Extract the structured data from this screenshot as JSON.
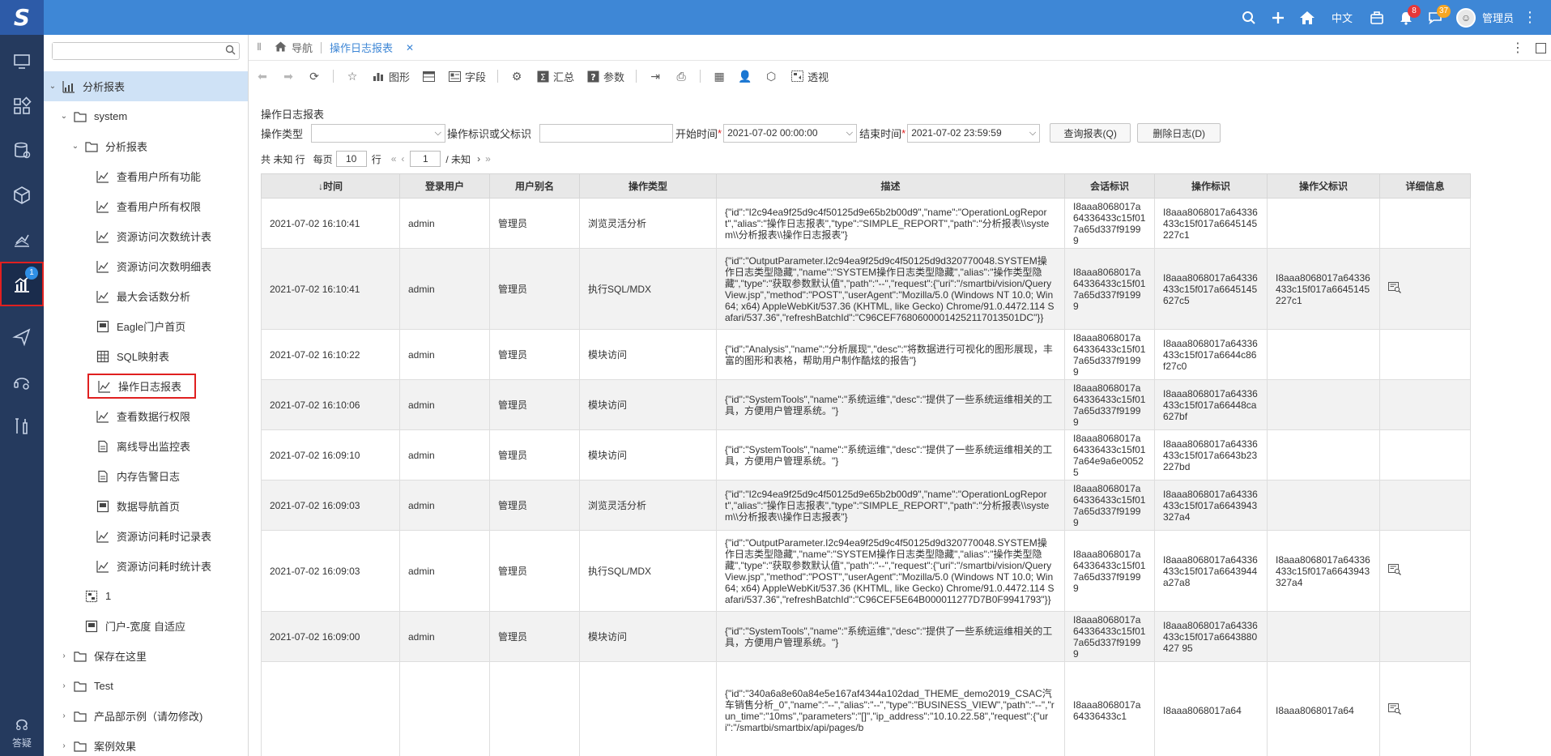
{
  "topbar": {
    "logo": "S",
    "lang": "中文",
    "notif_count": "8",
    "msg_count": "37",
    "user_name": "管理员"
  },
  "rail": {
    "active_badge": "1",
    "help_label": "答疑"
  },
  "tree": {
    "search_placeholder": "",
    "items": [
      {
        "label": "分析报表"
      },
      {
        "label": "system"
      },
      {
        "label": "分析报表"
      },
      {
        "label": "查看用户所有功能"
      },
      {
        "label": "查看用户所有权限"
      },
      {
        "label": "资源访问次数统计表"
      },
      {
        "label": "资源访问次数明细表"
      },
      {
        "label": "最大会话数分析"
      },
      {
        "label": "Eagle门户首页"
      },
      {
        "label": "SQL映射表"
      },
      {
        "label": "操作日志报表"
      },
      {
        "label": "查看数据行权限"
      },
      {
        "label": "离线导出监控表"
      },
      {
        "label": "内存告警日志"
      },
      {
        "label": "数据导航首页"
      },
      {
        "label": "资源访问耗时记录表"
      },
      {
        "label": "资源访问耗时统计表"
      },
      {
        "label": "1"
      },
      {
        "label": "门户-宽度 自适应"
      },
      {
        "label": "保存在这里"
      },
      {
        "label": "Test"
      },
      {
        "label": "产品部示例（请勿修改)"
      },
      {
        "label": "案例效果"
      }
    ]
  },
  "tabs": {
    "home": "导航",
    "active": "操作日志报表"
  },
  "toolbar": {
    "chart": "图形",
    "field": "字段",
    "summary": "汇总",
    "params": "参数",
    "pivot": "透视"
  },
  "report": {
    "title": "操作日志报表",
    "op_type_label": "操作类型",
    "op_type_value": "",
    "op_id_label": "操作标识或父标识",
    "op_id_value": "",
    "start_label": "开始时间",
    "start_value": "2021-07-02 00:00:00",
    "end_label": "结束时间",
    "end_value": "2021-07-02 23:59:59",
    "query_btn": "查询报表(Q)",
    "delete_btn": "删除日志(D)"
  },
  "pager": {
    "total": "共 未知 行",
    "per_page_label": "每页",
    "per_page": "10",
    "row_unit": "行",
    "page": "1",
    "of": "/ 未知"
  },
  "table": {
    "headers": [
      "↓时间",
      "登录用户",
      "用户别名",
      "操作类型",
      "描述",
      "会话标识",
      "操作标识",
      "操作父标识",
      "详细信息"
    ],
    "rows": [
      {
        "time": "2021-07-02  16:10:41",
        "user": "admin",
        "alias": "管理员",
        "type": "浏览灵活分析",
        "desc": "{\"id\":\"I2c94ea9f25d9c4f50125d9e65b2b00d9\",\"name\":\"OperationLogReport\",\"alias\":\"操作日志报表\",\"type\":\"SIMPLE_REPORT\",\"path\":\"分析报表\\\\system\\\\分析报表\\\\操作日志报表\"}",
        "session": "I8aaa8068017a64336433c15f017a65d337f91999",
        "op": "I8aaa8068017a64336433c15f017a6645145227c1",
        "parent": "",
        "detail": false
      },
      {
        "time": "2021-07-02  16:10:41",
        "user": "admin",
        "alias": "管理员",
        "type": "执行SQL/MDX",
        "desc": "{\"id\":\"OutputParameter.I2c94ea9f25d9c4f50125d9d320770048.SYSTEM操作日志类型隐藏\",\"name\":\"SYSTEM操作日志类型隐藏\",\"alias\":\"操作类型隐藏\",\"type\":\"获取参数默认值\",\"path\":\"--\",\"request\":{\"uri\":\"/smartbi/vision/QueryView.jsp\",\"method\":\"POST\",\"userAgent\":\"Mozilla/5.0 (Windows NT 10.0; Win64; x64) AppleWebKit/537.36 (KHTML, like Gecko) Chrome/91.0.4472.114 Safari/537.36\",\"refreshBatchId\":\"C96CEF76806000014252117013501​DC\"}}",
        "session": "I8aaa8068017a64336433c15f017a65d337f91999",
        "op": "I8aaa8068017a64336433c15f017a6645145627c5",
        "parent": "I8aaa8068017a64336433c15f017a6645145227c1",
        "detail": true
      },
      {
        "time": "2021-07-02  16:10:22",
        "user": "admin",
        "alias": "管理员",
        "type": "模块访问",
        "desc": "{\"id\":\"Analysis\",\"name\":\"分析展现\",\"desc\":\"将数据进行可视化的图形展现，丰富的图形和表格，帮助用户制作酷炫的报告\"}",
        "session": "I8aaa8068017a64336433c15f017a65d337f91999",
        "op": "I8aaa8068017a64336433c15f017a6644c86f27c0",
        "parent": "",
        "detail": false
      },
      {
        "time": "2021-07-02  16:10:06",
        "user": "admin",
        "alias": "管理员",
        "type": "模块访问",
        "desc": "{\"id\":\"SystemTools\",\"name\":\"系统运维\",\"desc\":\"提供了一些系统运维相关的工具，方便用户管理系统。\"}",
        "session": "I8aaa8068017a64336433c15f017a65d337f91999",
        "op": "I8aaa8068017a64336433c15f017a66448ca627bf",
        "parent": "",
        "detail": false
      },
      {
        "time": "2021-07-02  16:09:10",
        "user": "admin",
        "alias": "管理员",
        "type": "模块访问",
        "desc": "{\"id\":\"SystemTools\",\"name\":\"系统运维\",\"desc\":\"提供了一些系统运维相关的工具，方便用户管理系统。\"}",
        "session": "I8aaa8068017a64336433c15f017a64e9a6e00525",
        "op": "I8aaa8068017a64336433c15f017a6643b23227bd",
        "parent": "",
        "detail": false
      },
      {
        "time": "2021-07-02  16:09:03",
        "user": "admin",
        "alias": "管理员",
        "type": "浏览灵活分析",
        "desc": "{\"id\":\"I2c94ea9f25d9c4f50125d9e65b2b00d9\",\"name\":\"OperationLogReport\",\"alias\":\"操作日志报表\",\"type\":\"SIMPLE_REPORT\",\"path\":\"分析报表\\\\system\\\\分析报表\\\\操作日志报表\"}",
        "session": "I8aaa8068017a64336433c15f017a65d337f91999",
        "op": "I8aaa8068017a64336433c15f017a6643943327a4",
        "parent": "",
        "detail": false
      },
      {
        "time": "2021-07-02  16:09:03",
        "user": "admin",
        "alias": "管理员",
        "type": "执行SQL/MDX",
        "desc": "{\"id\":\"OutputParameter.I2c94ea9f25d9c4f50125d9d320770048.SYSTEM操作日志类型隐藏\",\"name\":\"SYSTEM操作日志类型隐藏\",\"alias\":\"操作类型隐藏\",\"type\":\"获取参数默认值\",\"path\":\"--\",\"request\":{\"uri\":\"/smartbi/vision/QueryView.jsp\",\"method\":\"POST\",\"userAgent\":\"Mozilla/5.0 (Windows NT 10.0; Win64; x64) AppleWebKit/537.36 (KHTML, like Gecko) Chrome/91.0.4472.114 Safari/537.36\",\"refreshBatchId\":\"C96CEF5E64B000011277D7B0F9941793\"}}",
        "session": "I8aaa8068017a64336433c15f017a65d337f91999",
        "op": "I8aaa8068017a64336433c15f017a6643944a27a8",
        "parent": "I8aaa8068017a64336433c15f017a6643943327a4",
        "detail": true
      },
      {
        "time": "2021-07-02  16:09:00",
        "user": "admin",
        "alias": "管理员",
        "type": "模块访问",
        "desc": "{\"id\":\"SystemTools\",\"name\":\"系统运维\",\"desc\":\"提供了一些系统运维相关的工具，方便用户管理系统。\"}",
        "session": "I8aaa8068017a64336433c15f017a65d337f91999",
        "op": "I8aaa8068017a64336433c15f017a6643880427 95",
        "parent": "",
        "detail": false
      },
      {
        "time": "",
        "user": "",
        "alias": "",
        "type": "",
        "desc": "{\"id\":\"340a6a8e60a84e5e167af4344a102dad_THEME_demo2019_CSAC汽车销售分析_0\",\"name\":\"--\",\"alias\":\"--\",\"type\":\"BUSINESS_VIEW\",\"path\":\"--\",\"run_time\":\"10ms\",\"parameters\":\"[]\",\"ip_address\":\"10.10.22.58\",\"request\":{\"uri\":\"/smartbi/smartbix/api/pages/b",
        "session": "I8aaa8068017a64336433c1",
        "op": "I8aaa8068017a64",
        "parent": "I8aaa8068017a64",
        "detail": true
      }
    ]
  }
}
